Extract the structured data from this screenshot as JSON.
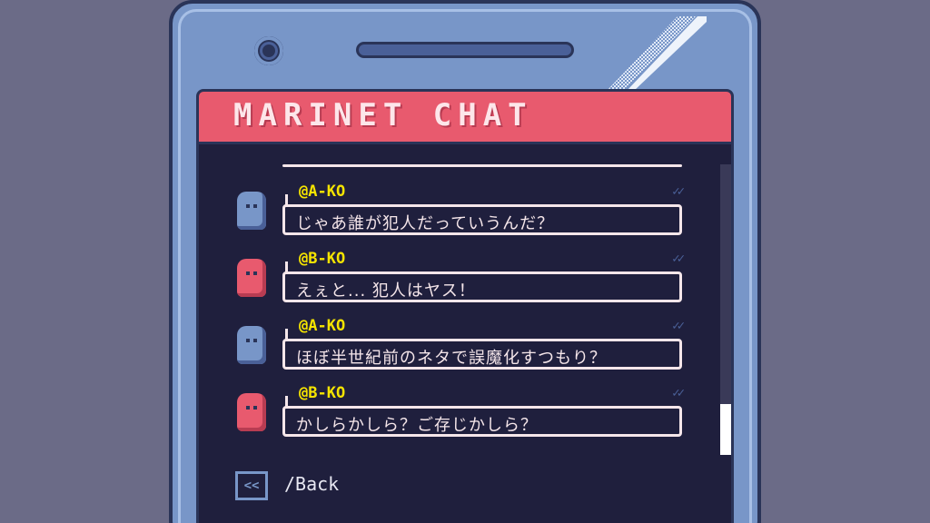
{
  "app": {
    "title": "MARINET CHAT"
  },
  "messages": [
    {
      "handle": "@A-KO",
      "text": "じゃあ誰が犯人だっていうんだ？",
      "avatar": "blue-avatar"
    },
    {
      "handle": "@B-KO",
      "text": "えぇと... 犯人はヤス！",
      "avatar": "pink-avatar"
    },
    {
      "handle": "@A-KO",
      "text": "ほぼ半世紀前のネタで誤魔化すつもり？",
      "avatar": "blue-avatar"
    },
    {
      "handle": "@B-KO",
      "text": "かしらかしら？ご存じかしら？",
      "avatar": "pink-avatar"
    }
  ],
  "read_mark": "✓✓",
  "back": {
    "icon": "<<",
    "label": "/Back"
  },
  "colors": {
    "titlebar": "#e85a6e",
    "screen": "#1f1f3d",
    "phone": "#7896c8",
    "handle": "#f5e400",
    "bubble": "#f5e6ea"
  }
}
